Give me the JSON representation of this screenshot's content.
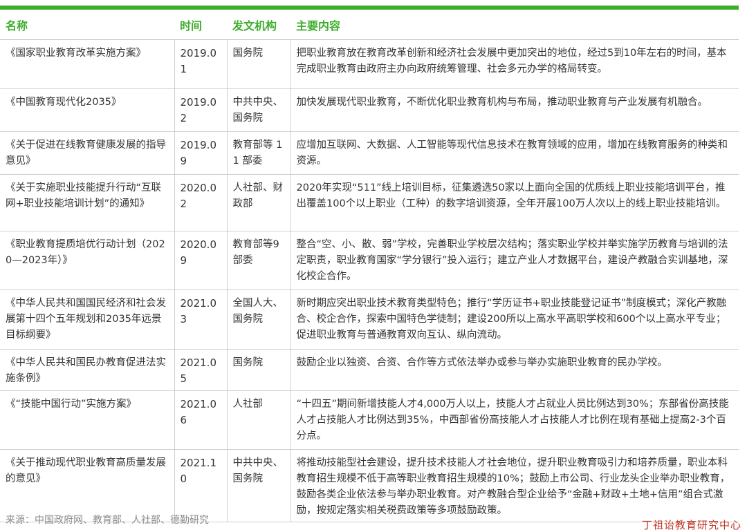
{
  "table": {
    "header": {
      "name": "名称",
      "time": "时间",
      "org": "发文机构",
      "content": "主要内容"
    },
    "rows": [
      {
        "name": "《国家职业教育改革实施方案》",
        "time": "2019.01",
        "org": "国务院",
        "content": "把职业教育放在教育改革创新和经济社会发展中更加突出的地位，经过5到10年左右的时间，基本完成职业教育由政府主办向政府统筹管理、社会多元办学的格局转变。"
      },
      {
        "name": "《中国教育现代化2035》",
        "time": "2019.02",
        "org": "中共中央、国务院",
        "content": "加快发展现代职业教育，不断优化职业教育机构与布局，推动职业教育与产业发展有机融合。"
      },
      {
        "name": "《关于促进在线教育健康发展的指导意见》",
        "time": "2019.09",
        "org": "教育部等 11 部委",
        "content": "应增加互联网、大数据、人工智能等现代信息技术在教育领域的应用，增加在线教育服务的种类和资源。"
      },
      {
        "name": "《关于实施职业技能提升行动“互联网+职业技能培训计划”的通知》",
        "time": "2020.02",
        "org": "人社部、财政部",
        "content": "2020年实现“511”线上培训目标，征集遴选50家以上面向全国的优质线上职业技能培训平台，推出覆盖100个以上职业（工种）的数字培训资源，全年开展100万人次以上的线上职业技能培训。"
      },
      {
        "name": "《职业教育提质培优行动计划（2020—2023年）》",
        "time": "2020.09",
        "org": "教育部等9部委",
        "content": "整合“空、小、散、弱”学校，完善职业学校层次结构；落实职业学校并举实施学历教育与培训的法定职责，职业教育国家“学分银行”投入运行；建立产业人才数据平台，建设产教融合实训基地，深化校企合作。"
      },
      {
        "name": "《中华人民共和国国民经济和社会发展第十四个五年规划和2035年远景目标纲要》",
        "time": "2021.03",
        "org": "全国人大、国务院",
        "content": "新时期应突出职业技术教育类型特色；推行“学历证书+职业技能登记证书”制度模式；深化产教融合、校企合作，探索中国特色学徒制；建设200所以上高水平高职学校和600个以上高水平专业；促进职业教育与普通教育双向互认、纵向流动。"
      },
      {
        "name": "《中华人民共和国民办教育促进法实施条例》",
        "time": "2021.05",
        "org": "国务院",
        "content": "鼓励企业以独资、合资、合作等方式依法举办或参与举办实施职业教育的民办学校。"
      },
      {
        "name": "《“技能中国行动”实施方案》",
        "time": "2021.06",
        "org": "人社部",
        "content": "“十四五”期间新增技能人才4,000万人以上，技能人才占就业人员比例达到30%；东部省份高技能人才占技能人才比例达到35%，中西部省份高技能人才占技能人才比例在现有基础上提高2-3个百分点。"
      },
      {
        "name": "《关于推动现代职业教育高质量发展的意见》",
        "time": "2021.10",
        "org": "中共中央、国务院",
        "content": "将推动技能型社会建设，提升技术技能人才社会地位，提升职业教育吸引力和培养质量，职业本科教育招生规模不低于高等职业教育招生规模的10%；鼓励上市公司、行业龙头企业举办职业教育，鼓励各类企业依法参与举办职业教育。对产教融合型企业给予“金融+财政+土地+信用”组合式激励，按规定落实相关税费政策等多项鼓励政策。"
      }
    ]
  },
  "source": "来源：中国政府网、教育部、人社部、德勤研究",
  "watermark": "丁祖诒教育研究中心",
  "colors": {
    "accent_green": "#3dae2b",
    "watermark_red": "#c0392b"
  }
}
